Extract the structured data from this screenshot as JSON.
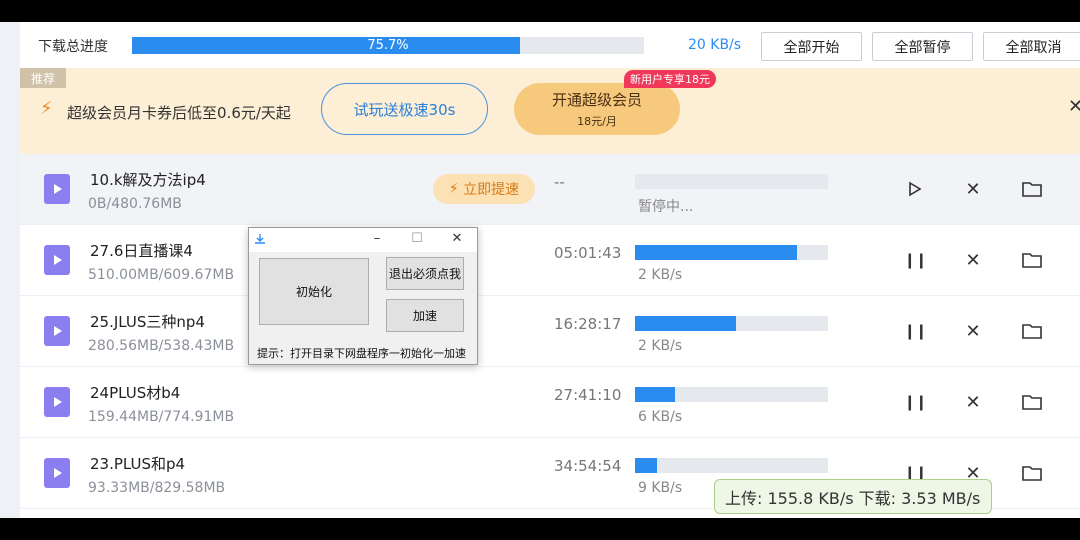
{
  "header": {
    "label": "下载总进度",
    "progress_percent": 75.7,
    "progress_text": "75.7%",
    "speed": "20 KB/s",
    "buttons": {
      "start_all": "全部开始",
      "pause_all": "全部暂停",
      "cancel_all": "全部取消"
    }
  },
  "promo": {
    "tag": "推荐",
    "text": "超级会员月卡券后低至0.6元/天起",
    "try_label": "试玩送极速30s",
    "vip_label": "开通超级会员",
    "vip_price": "18元/月",
    "badge": "新用户专享18元"
  },
  "rows": [
    {
      "name": "10.k解及方法ip4",
      "size": "0B/480.76MB",
      "boost": "立即提速",
      "remaining": "--",
      "progress": 0,
      "status": "暂停中..."
    },
    {
      "name": "27.6日直播课4",
      "size": "510.00MB/609.67MB",
      "remaining": "05:01:43",
      "progress": 83.7,
      "status": "2 KB/s"
    },
    {
      "name": "25.JLUS三种np4",
      "size": "280.56MB/538.43MB",
      "remaining": "16:28:17",
      "progress": 52.1,
      "status": "2 KB/s"
    },
    {
      "name": "24PLUS材b4",
      "size": "159.44MB/774.91MB",
      "remaining": "27:41:10",
      "progress": 20.6,
      "status": "6 KB/s"
    },
    {
      "name": "23.PLUS和p4",
      "size": "93.33MB/829.58MB",
      "remaining": "34:54:54",
      "progress": 11.3,
      "status": "9 KB/s"
    }
  ],
  "dialog": {
    "init_label": "初始化",
    "exit_label": "退出必须点我",
    "speedup_label": "加速",
    "hint": "提示：打开目录下网盘程序一初始化一加速"
  },
  "netspeed": {
    "text": "上传: 155.8 KB/s 下载: 3.53 MB/s"
  },
  "colors": {
    "accent": "#2b8cf0",
    "file_icon": "#8b7ef0",
    "promo_bg": "#fcefd6",
    "badge": "#f0385a"
  }
}
